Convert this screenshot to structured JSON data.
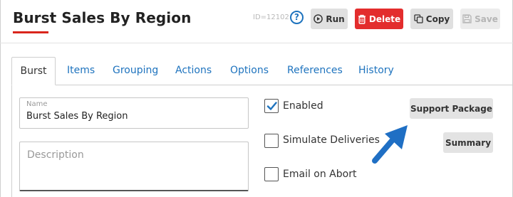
{
  "header": {
    "title": "Burst Sales By Region",
    "id_label": "ID=12102",
    "help_glyph": "?"
  },
  "toolbar": {
    "run_label": "Run",
    "delete_label": "Delete",
    "copy_label": "Copy",
    "save_label": "Save"
  },
  "tabs": [
    {
      "label": "Burst",
      "active": true
    },
    {
      "label": "Items"
    },
    {
      "label": "Grouping"
    },
    {
      "label": "Actions"
    },
    {
      "label": "Options"
    },
    {
      "label": "References"
    },
    {
      "label": "History"
    }
  ],
  "form": {
    "name_label": "Name",
    "name_value": "Burst Sales By Region",
    "description_placeholder": "Description",
    "checkboxes": [
      {
        "label": "Enabled",
        "checked": true
      },
      {
        "label": "Simulate Deliveries",
        "checked": false
      },
      {
        "label": "Email on Abort",
        "checked": false
      }
    ],
    "support_package_label": "Support Package",
    "summary_label": "Summary"
  },
  "colors": {
    "accent_blue": "#1e73be",
    "delete_red": "#e32d2d",
    "title_underline": "#d9261c",
    "annotation_arrow": "#1f6fc4"
  },
  "icons": {
    "run": "play-circle-icon",
    "delete": "trash-icon",
    "copy": "copy-icon",
    "save": "floppy-disk-icon",
    "help": "question-circle-icon",
    "check": "checkmark-icon",
    "annotation": "arrow-icon"
  }
}
